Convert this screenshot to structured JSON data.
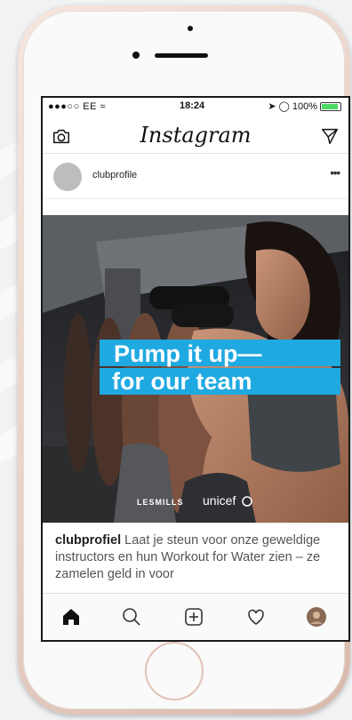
{
  "status_bar": {
    "carrier": "●●●○○ EE",
    "time": "18:24",
    "battery": "100%",
    "battery_level": 1.0
  },
  "header": {
    "logo": "Instagram",
    "left_icon": "camera-icon",
    "right_icon": "send-icon"
  },
  "post": {
    "username": "clubprofile",
    "menu_icon": "more-icon",
    "image": {
      "headline_line1": "Pump it up—",
      "headline_line2": "for our team",
      "brand_lesmills": "LESMILLS",
      "brand_unicef": "unicef"
    },
    "caption_user": "clubprofiel",
    "caption_text": " Laat je steun voor onze geweldige instructors en hun Workout for Water zien – ze zamelen geld in voor"
  },
  "bottom_nav": {
    "items": [
      "home-icon",
      "search-icon",
      "add-post-icon",
      "activity-heart-icon",
      "profile-avatar-icon"
    ]
  },
  "colors": {
    "headline_bg": "#1fa9e1",
    "phone_body": "#ead3c9"
  }
}
